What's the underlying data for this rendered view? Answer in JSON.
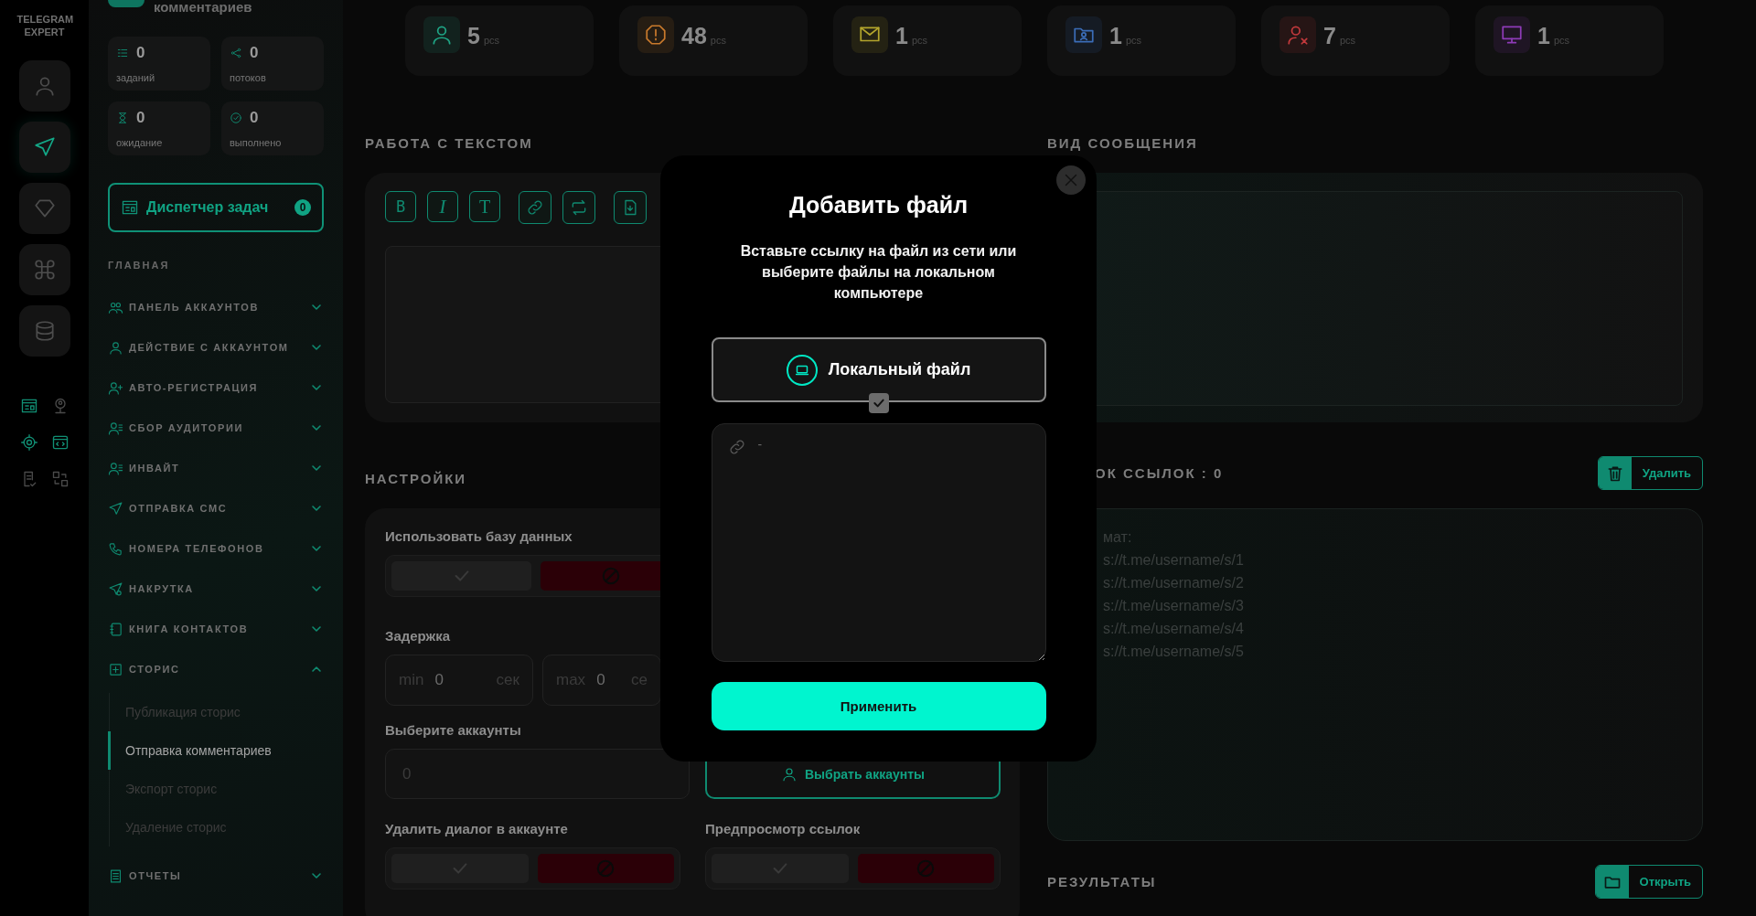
{
  "rail": {
    "logo": "TELEGRAM EXPERT",
    "nav": [
      {
        "selected": false
      },
      {
        "selected": true
      },
      {
        "selected": false
      },
      {
        "selected": false
      },
      {
        "selected": false
      }
    ]
  },
  "sidebar": {
    "page_title": "комментариев",
    "counters": [
      {
        "value": "0",
        "label": "заданий"
      },
      {
        "value": "0",
        "label": "потоков"
      },
      {
        "value": "0",
        "label": "ожидание"
      },
      {
        "value": "0",
        "label": "выполнено"
      }
    ],
    "task_manager": {
      "label": "Диспетчер задач",
      "count": "0"
    },
    "section": "ГЛАВНАЯ",
    "menu": [
      {
        "label": "ПАНЕЛЬ АККАУНТОВ",
        "expanded": false
      },
      {
        "label": "ДЕЙСТВИЕ С АККАУНТОМ",
        "expanded": false
      },
      {
        "label": "АВТО-РЕГИСТРАЦИЯ",
        "expanded": false
      },
      {
        "label": "СБОР АУДИТОРИИ",
        "expanded": false
      },
      {
        "label": "ИНВАЙТ",
        "expanded": false
      },
      {
        "label": "ОТПРАВКА СМС",
        "expanded": false
      },
      {
        "label": "НОМЕРА ТЕЛЕФОНОВ",
        "expanded": false
      },
      {
        "label": "НАКРУТКА",
        "expanded": false
      },
      {
        "label": "КНИГА КОНТАКТОВ",
        "expanded": false
      },
      {
        "label": "СТОРИС",
        "expanded": true,
        "children": [
          {
            "label": "Публикация сторис",
            "selected": false
          },
          {
            "label": "Отправка комментариев",
            "selected": true
          },
          {
            "label": "Экспорт сторис",
            "selected": false
          },
          {
            "label": "Удаление сторис",
            "selected": false
          }
        ]
      },
      {
        "label": "ОТЧЕТЫ",
        "expanded": false
      }
    ]
  },
  "stats": [
    {
      "value": "5",
      "unit": "pcs",
      "color": "#1fa585"
    },
    {
      "value": "48",
      "unit": "pcs",
      "color": "#c97a2c"
    },
    {
      "value": "1",
      "unit": "pcs",
      "color": "#b3a52c"
    },
    {
      "value": "1",
      "unit": "pcs",
      "color": "#3b6db8"
    },
    {
      "value": "7",
      "unit": "pcs",
      "color": "#c2393c"
    },
    {
      "value": "1",
      "unit": "pcs",
      "color": "#8e3bb8"
    }
  ],
  "text_work": {
    "heading": "РАБОТА С ТЕКСТОМ",
    "format_buttons": [
      "B",
      "I",
      "T"
    ]
  },
  "settings": {
    "heading": "НАСТРОЙКИ",
    "use_database": {
      "label": "Использовать базу данных",
      "on": false
    },
    "delay": {
      "label": "Задержка",
      "min": {
        "prefix": "min",
        "value": "0",
        "unit": "сек"
      },
      "max": {
        "prefix": "max",
        "value": "0",
        "unit": "се"
      }
    },
    "accounts": {
      "label": "Выберите аккаунты",
      "placeholder": "0",
      "button": "Выбрать аккаунты"
    },
    "delete_dialog": {
      "label": "Удалить диалог в аккаунте",
      "on": false
    },
    "link_preview": {
      "label": "Предпросмотр ссылок",
      "on": false
    }
  },
  "message_view": {
    "heading": "ВИД СООБЩЕНИЯ"
  },
  "links": {
    "heading": "ОК ССЫЛОК : 0",
    "delete_button": "Удалить",
    "placeholder": "мат:\ns://t.me/username/s/1\ns://t.me/username/s/2\ns://t.me/username/s/3\ns://t.me/username/s/4\ns://t.me/username/s/5"
  },
  "results": {
    "heading": "РЕЗУЛЬТАТЫ",
    "open_button": "Открыть"
  },
  "modal": {
    "title": "Добавить файл",
    "description": "Вставьте ссылку на файл из сети или выберите файлы на локальном компьютере",
    "option": {
      "label": "Локальный файл",
      "checked": true
    },
    "link_placeholder": "-",
    "apply_button": "Применить"
  }
}
